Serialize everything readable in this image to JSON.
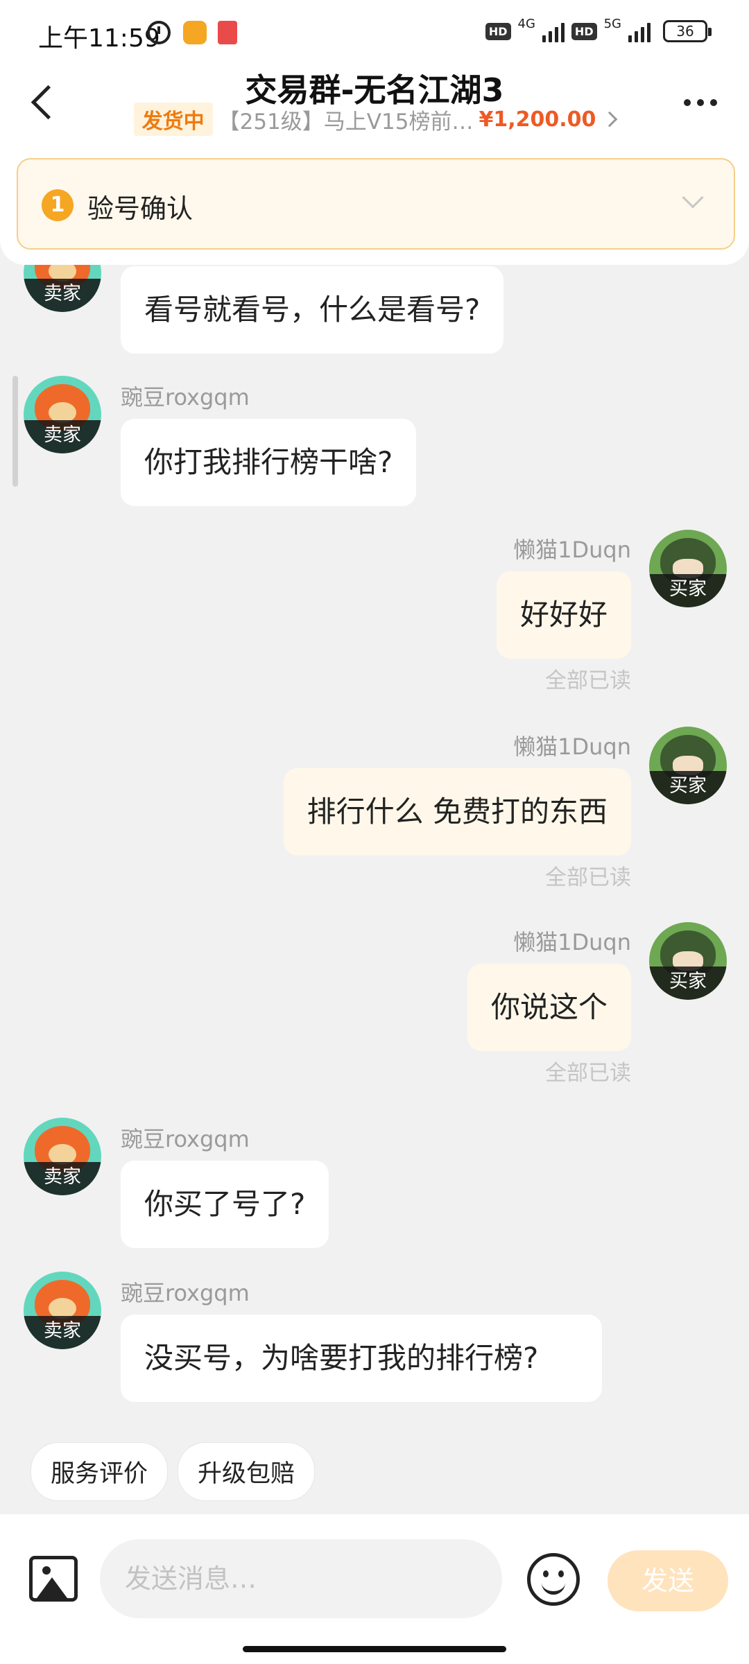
{
  "status_bar": {
    "time": "上午11:59",
    "net1": "4G",
    "net2": "5G",
    "hd": "HD",
    "battery": "36"
  },
  "header": {
    "title": "交易群-无名江湖3",
    "order_status": "发货中",
    "order_desc": "【251级】马上V15榜前…",
    "order_price": "¥1,200.00"
  },
  "verify": {
    "step": "1",
    "label": "验号确认"
  },
  "messages": [
    {
      "side": "left",
      "role": "卖家",
      "sender": "",
      "text": "看号就看号，什么是看号?"
    },
    {
      "side": "left",
      "role": "卖家",
      "sender": "豌豆roxgqm",
      "text": "你打我排行榜干啥?"
    },
    {
      "side": "right",
      "role": "买家",
      "sender": "懒猫1Duqn",
      "text": "好好好",
      "status": "全部已读"
    },
    {
      "side": "right",
      "role": "买家",
      "sender": "懒猫1Duqn",
      "text": "排行什么 免费打的东西",
      "status": "全部已读"
    },
    {
      "side": "right",
      "role": "买家",
      "sender": "懒猫1Duqn",
      "text": "你说这个",
      "status": "全部已读"
    },
    {
      "side": "left",
      "role": "卖家",
      "sender": "豌豆roxgqm",
      "text": "你买了号了?"
    },
    {
      "side": "left",
      "role": "卖家",
      "sender": "豌豆roxgqm",
      "text": "没买号，为啥要打我的排行榜?"
    }
  ],
  "quick_actions": [
    "服务评价",
    "升级包赔"
  ],
  "input": {
    "placeholder": "发送消息…",
    "send_label": "发送"
  },
  "colors": {
    "accent": "#f5a623",
    "price": "#ee5a24",
    "own_bubble": "#fff8ea"
  }
}
